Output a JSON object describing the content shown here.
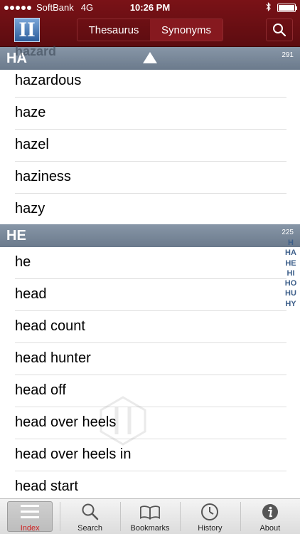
{
  "status_bar": {
    "carrier": "SoftBank",
    "network": "4G",
    "time": "10:26 PM"
  },
  "header": {
    "logo_letter": "II",
    "segments": [
      "Thesaurus",
      "Synonyms"
    ],
    "active_segment": "Synonyms",
    "search_icon": "search-icon"
  },
  "ghost_word": "hazard",
  "sections": [
    {
      "title": "HA",
      "count": "291",
      "rows": [
        "hazardous",
        "haze",
        "hazel",
        "haziness",
        "hazy"
      ]
    },
    {
      "title": "HE",
      "count": "225",
      "rows": [
        "he",
        "head",
        "head count",
        "head hunter",
        "head off",
        "head over heels",
        "head over heels in",
        "head start"
      ]
    }
  ],
  "index_strip": [
    "H",
    "HA",
    "HE",
    "HI",
    "HO",
    "HU",
    "HY"
  ],
  "tabbar": {
    "active": "Index",
    "tabs": [
      {
        "label": "Index",
        "icon": "list-icon"
      },
      {
        "label": "Search",
        "icon": "search-icon"
      },
      {
        "label": "Bookmarks",
        "icon": "book-icon"
      },
      {
        "label": "History",
        "icon": "clock-icon"
      },
      {
        "label": "About",
        "icon": "info-icon"
      }
    ]
  },
  "colors": {
    "toolbar_red": "#6b1015",
    "section_header": "#7a8899",
    "index_blue": "#3d5f8a",
    "active_tab_label": "#d02020"
  }
}
